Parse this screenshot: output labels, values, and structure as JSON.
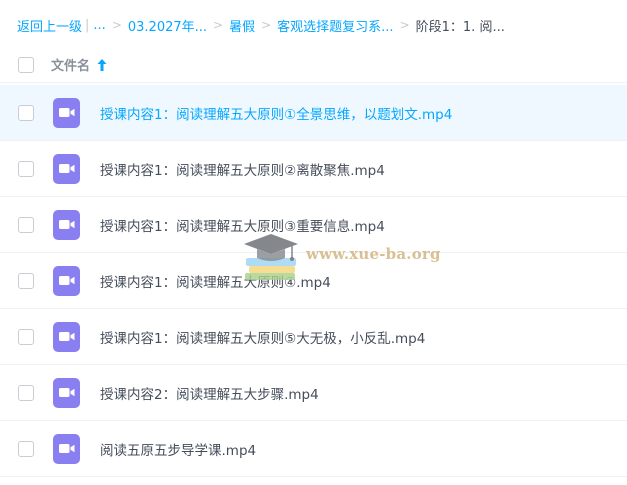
{
  "breadcrumb": {
    "back_label": "返回上一级",
    "ellipsis": "...",
    "items": [
      "03.2027年...",
      "暑假",
      "客观选择题复习系...",
      "阶段1：1. 阅..."
    ]
  },
  "header": {
    "column_label": "文件名",
    "sort_icon": "arrow-up-icon"
  },
  "files": [
    {
      "name": "授课内容1：阅读理解五大原则①全景思维，以题划文.mp4",
      "icon": "video-file-icon",
      "selected": true
    },
    {
      "name": "授课内容1：阅读理解五大原则②离散聚焦.mp4",
      "icon": "video-file-icon",
      "selected": false
    },
    {
      "name": "授课内容1：阅读理解五大原则③重要信息.mp4",
      "icon": "video-file-icon",
      "selected": false
    },
    {
      "name": "授课内容1：阅读理解五大原则④.mp4",
      "icon": "video-file-icon",
      "selected": false
    },
    {
      "name": "授课内容1：阅读理解五大原则⑤大无极，小反乱.mp4",
      "icon": "video-file-icon",
      "selected": false
    },
    {
      "name": "授课内容2：阅读理解五大步骤.mp4",
      "icon": "video-file-icon",
      "selected": false
    },
    {
      "name": "阅读五原五步导学课.mp4",
      "icon": "video-file-icon",
      "selected": false
    }
  ],
  "watermark": {
    "text": "www.xue-ba.org"
  },
  "colors": {
    "accent": "#06a7ff",
    "file_icon": "#8a7ff1",
    "selected_row": "#eef8fe"
  }
}
